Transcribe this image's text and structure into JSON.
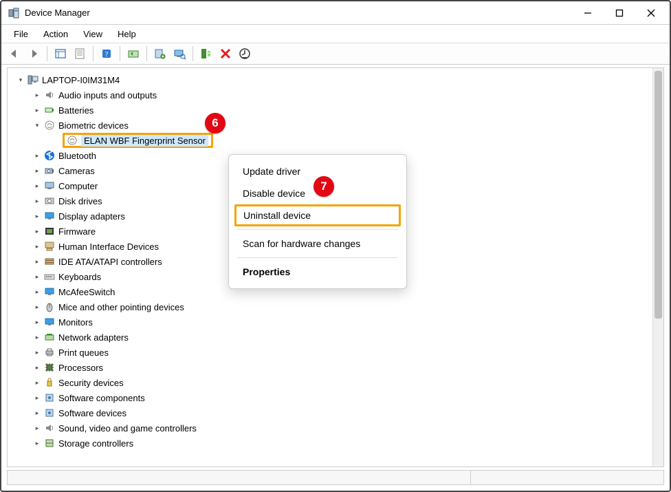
{
  "window": {
    "title": "Device Manager"
  },
  "menu": {
    "file": "File",
    "action": "Action",
    "view": "View",
    "help": "Help"
  },
  "toolbar_icons": [
    "back-icon",
    "forward-icon",
    "sep",
    "show-hidden-icon",
    "properties-icon",
    "sep",
    "help-icon",
    "sep",
    "update-driver-icon",
    "sep",
    "scan-hardware-icon",
    "uninstall-legacy-icon",
    "sep",
    "add-hardware-icon",
    "remove-icon",
    "more-icon"
  ],
  "tree": {
    "root": "LAPTOP-I0IM31M4",
    "categories": [
      {
        "label": "Audio inputs and outputs",
        "icon": "speaker"
      },
      {
        "label": "Batteries",
        "icon": "battery"
      },
      {
        "label": "Biometric devices",
        "icon": "fingerprint",
        "expanded": true,
        "children": [
          {
            "label": "ELAN WBF Fingerprint Sensor",
            "icon": "fingerprint",
            "selected": true,
            "highlighted": true
          }
        ]
      },
      {
        "label": "Bluetooth",
        "icon": "bluetooth"
      },
      {
        "label": "Cameras",
        "icon": "camera"
      },
      {
        "label": "Computer",
        "icon": "computer"
      },
      {
        "label": "Disk drives",
        "icon": "disk"
      },
      {
        "label": "Display adapters",
        "icon": "display"
      },
      {
        "label": "Firmware",
        "icon": "firmware"
      },
      {
        "label": "Human Interface Devices",
        "icon": "hid"
      },
      {
        "label": "IDE ATA/ATAPI controllers",
        "icon": "ide"
      },
      {
        "label": "Keyboards",
        "icon": "keyboard"
      },
      {
        "label": "McAfeeSwitch",
        "icon": "display"
      },
      {
        "label": "Mice and other pointing devices",
        "icon": "mouse"
      },
      {
        "label": "Monitors",
        "icon": "display"
      },
      {
        "label": "Network adapters",
        "icon": "network"
      },
      {
        "label": "Print queues",
        "icon": "printer"
      },
      {
        "label": "Processors",
        "icon": "cpu"
      },
      {
        "label": "Security devices",
        "icon": "security"
      },
      {
        "label": "Software components",
        "icon": "software"
      },
      {
        "label": "Software devices",
        "icon": "software"
      },
      {
        "label": "Sound, video and game controllers",
        "icon": "speaker"
      },
      {
        "label": "Storage controllers",
        "icon": "storage"
      }
    ]
  },
  "context_menu": {
    "update": "Update driver",
    "disable": "Disable device",
    "uninstall": "Uninstall device",
    "scan": "Scan for hardware changes",
    "properties": "Properties"
  },
  "callouts": {
    "six": "6",
    "seven": "7"
  },
  "colors": {
    "highlight": "#f5a300",
    "selection": "#cde8ff",
    "callout": "#e30613"
  }
}
